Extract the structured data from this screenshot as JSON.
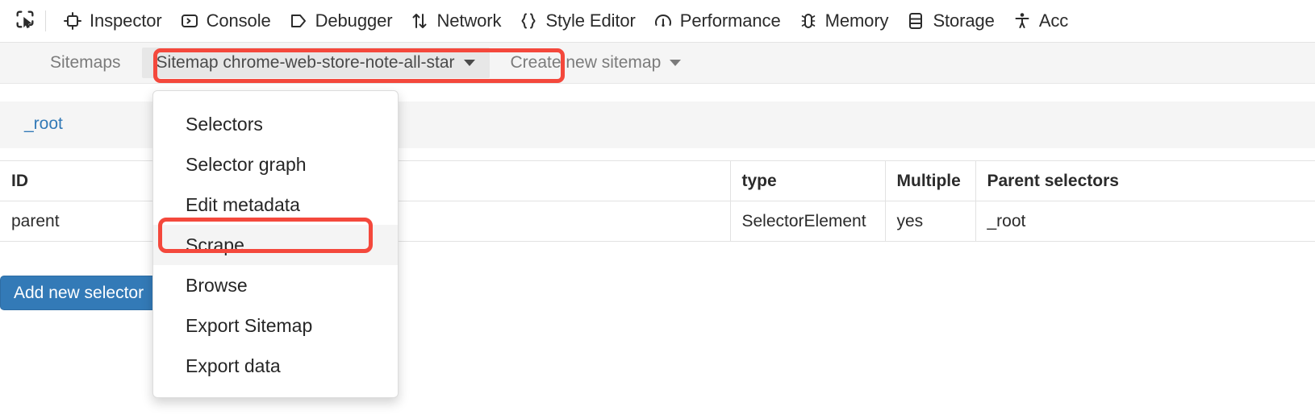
{
  "devtools_toolbar": {
    "picker_icon": "element-picker-icon",
    "tabs": [
      {
        "label": "Inspector",
        "icon": "inspector-icon"
      },
      {
        "label": "Console",
        "icon": "console-icon"
      },
      {
        "label": "Debugger",
        "icon": "debugger-icon"
      },
      {
        "label": "Network",
        "icon": "network-icon"
      },
      {
        "label": "Style Editor",
        "icon": "style-editor-icon"
      },
      {
        "label": "Performance",
        "icon": "performance-icon"
      },
      {
        "label": "Memory",
        "icon": "memory-icon"
      },
      {
        "label": "Storage",
        "icon": "storage-icon"
      },
      {
        "label": "Acc",
        "icon": "accessibility-icon"
      }
    ]
  },
  "sitemap_nav": {
    "sitemaps_label": "Sitemaps",
    "active_sitemap_label": "Sitemap chrome-web-store-note-all-star",
    "create_new_label": "Create new sitemap"
  },
  "breadcrumb": {
    "root_label": "_root"
  },
  "selector_table": {
    "columns": [
      "ID",
      "type",
      "Multiple",
      "Parent selectors"
    ],
    "rows": [
      {
        "id": "parent",
        "type": "SelectorElement",
        "multiple": "yes",
        "parent_selectors": "_root"
      }
    ]
  },
  "actions": {
    "add_new_selector_label": "Add new selector"
  },
  "sitemap_dropdown": {
    "items": [
      {
        "label": "Selectors",
        "hovered": false
      },
      {
        "label": "Selector graph",
        "hovered": false
      },
      {
        "label": "Edit metadata",
        "hovered": false
      },
      {
        "label": "Scrape",
        "hovered": true
      },
      {
        "label": "Browse",
        "hovered": false
      },
      {
        "label": "Export Sitemap",
        "hovered": false
      },
      {
        "label": "Export data",
        "hovered": false
      }
    ]
  },
  "annotations": {
    "highlight_color": "#f4483c",
    "targets": [
      "sitemap-dropdown-toggle",
      "menu-item-scrape"
    ]
  },
  "colors": {
    "primary_button": "#337ab7",
    "link": "#337ab7",
    "navbar_bg": "#f5f5f5",
    "highlight": "#f4483c"
  }
}
